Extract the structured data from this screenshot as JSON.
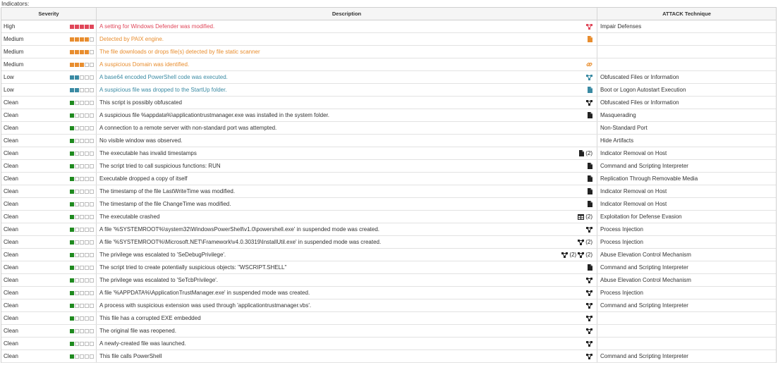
{
  "section_title": "Indicators:",
  "columns": {
    "severity": "Severity",
    "description": "Description",
    "technique": "ATTACK Technique"
  },
  "severity_colors": {
    "High": "#e0475a",
    "Medium": "#e88d2e",
    "Low": "#3a8aa3",
    "Clean": "#1f8a1f"
  },
  "rows": [
    {
      "severity": "High",
      "level": 5,
      "description": "A setting for Windows Defender was modified.",
      "icons": [
        "graph-icon"
      ],
      "count": "",
      "technique": "Impair Defenses"
    },
    {
      "severity": "Medium",
      "level": 4,
      "description": "Detected by PAIX engine.",
      "icons": [
        "file-icon"
      ],
      "count": "",
      "technique": ""
    },
    {
      "severity": "Medium",
      "level": 4,
      "description": "The file downloads or drops file(s) detected by file static scanner",
      "icons": [],
      "count": "",
      "technique": ""
    },
    {
      "severity": "Medium",
      "level": 3,
      "description": "A suspicious Domain was identified.",
      "icons": [
        "link-icon"
      ],
      "count": "",
      "technique": ""
    },
    {
      "severity": "Low",
      "level": 2,
      "description": "A base64 encoded PowerShell code was executed.",
      "icons": [
        "graph-icon"
      ],
      "count": "",
      "technique": "Obfuscated Files or Information"
    },
    {
      "severity": "Low",
      "level": 2,
      "description": "A suspicious file was dropped to the StartUp folder.",
      "icons": [
        "file-icon"
      ],
      "count": "",
      "technique": "Boot or Logon Autostart Execution"
    },
    {
      "severity": "Clean",
      "level": 1,
      "description": "This script is possibly obfuscated",
      "icons": [
        "graph-icon"
      ],
      "count": "",
      "technique": "Obfuscated Files or Information"
    },
    {
      "severity": "Clean",
      "level": 1,
      "description": "A suspicious file %appdata%\\applicationtrustmanager.exe was installed in the system folder.",
      "icons": [
        "file-icon"
      ],
      "count": "",
      "technique": "Masquerading"
    },
    {
      "severity": "Clean",
      "level": 1,
      "description": "A connection to a remote server with non-standard port was attempted.",
      "icons": [],
      "count": "",
      "technique": "Non-Standard Port"
    },
    {
      "severity": "Clean",
      "level": 1,
      "description": "No visible window was observed.",
      "icons": [],
      "count": "",
      "technique": "Hide Artifacts"
    },
    {
      "severity": "Clean",
      "level": 1,
      "description": "The executable has invalid timestamps",
      "icons": [
        "file-icon"
      ],
      "count": "(2)",
      "technique": "Indicator Removal on Host"
    },
    {
      "severity": "Clean",
      "level": 1,
      "description": "The script tried to call suspicious functions: RUN",
      "icons": [
        "file-icon"
      ],
      "count": "",
      "technique": "Command and Scripting Interpreter"
    },
    {
      "severity": "Clean",
      "level": 1,
      "description": "Executable dropped a copy of itself",
      "icons": [
        "file-icon"
      ],
      "count": "",
      "technique": "Replication Through Removable Media"
    },
    {
      "severity": "Clean",
      "level": 1,
      "description": "The timestamp of the file LastWriteTime was modified.",
      "icons": [
        "file-icon"
      ],
      "count": "",
      "technique": "Indicator Removal on Host"
    },
    {
      "severity": "Clean",
      "level": 1,
      "description": "The timestamp of the file ChangeTime was modified.",
      "icons": [
        "file-icon"
      ],
      "count": "",
      "technique": "Indicator Removal on Host"
    },
    {
      "severity": "Clean",
      "level": 1,
      "description": "The executable crashed",
      "icons": [
        "table-icon"
      ],
      "count": "(2)",
      "technique": "Exploitation for Defense Evasion"
    },
    {
      "severity": "Clean",
      "level": 1,
      "description": "A file '%SYSTEMROOT%\\system32\\WindowsPowerShell\\v1.0\\powershell.exe' in suspended mode was created.",
      "icons": [
        "graph-icon"
      ],
      "count": "",
      "technique": "Process Injection"
    },
    {
      "severity": "Clean",
      "level": 1,
      "description": "A file '%SYSTEMROOT%\\Microsoft.NET\\Framework\\v4.0.30319\\InstallUtil.exe' in suspended mode was created.",
      "icons": [
        "graph-icon"
      ],
      "count": "(2)",
      "technique": "Process Injection"
    },
    {
      "severity": "Clean",
      "level": 1,
      "description": "The privilege was escalated to 'SeDebugPrivilege'.",
      "icons": [
        "graph-icon",
        "graph-icon"
      ],
      "count": "(2)",
      "technique": "Abuse Elevation Control Mechanism"
    },
    {
      "severity": "Clean",
      "level": 1,
      "description": "The script tried to create potentially suspicious objects: \"WSCRIPT.SHELL\"",
      "icons": [
        "file-icon"
      ],
      "count": "",
      "technique": "Command and Scripting Interpreter"
    },
    {
      "severity": "Clean",
      "level": 1,
      "description": "The privilege was escalated to 'SeTcbPrivilege'.",
      "icons": [
        "graph-icon"
      ],
      "count": "",
      "technique": "Abuse Elevation Control Mechanism"
    },
    {
      "severity": "Clean",
      "level": 1,
      "description": "A file '%APPDATA%\\ApplicationTrustManager.exe' in suspended mode was created.",
      "icons": [
        "graph-icon"
      ],
      "count": "",
      "technique": "Process Injection"
    },
    {
      "severity": "Clean",
      "level": 1,
      "description": "A process with suspicious extension was used through 'applicationtrustmanager.vbs'.",
      "icons": [
        "graph-icon"
      ],
      "count": "",
      "technique": "Command and Scripting Interpreter"
    },
    {
      "severity": "Clean",
      "level": 1,
      "description": "This file has a corrupted EXE embedded",
      "icons": [
        "graph-icon"
      ],
      "count": "",
      "technique": ""
    },
    {
      "severity": "Clean",
      "level": 1,
      "description": "The original file was reopened.",
      "icons": [
        "graph-icon"
      ],
      "count": "",
      "technique": ""
    },
    {
      "severity": "Clean",
      "level": 1,
      "description": "A newly-created file was launched.",
      "icons": [
        "graph-icon"
      ],
      "count": "",
      "technique": ""
    },
    {
      "severity": "Clean",
      "level": 1,
      "description": "This file calls PowerShell",
      "icons": [
        "graph-icon"
      ],
      "count": "",
      "technique": "Command and Scripting Interpreter"
    }
  ]
}
